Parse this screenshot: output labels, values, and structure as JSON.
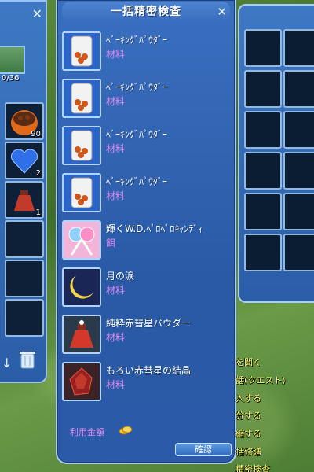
{
  "main": {
    "title": "一括精密検査",
    "items": [
      {
        "name": "ﾍﾞｰｷﾝｸﾞﾊﾟｳﾀﾞｰ",
        "type": "材料",
        "icon": "baking-powder-can-icon"
      },
      {
        "name": "ﾍﾞｰｷﾝｸﾞﾊﾟｳﾀﾞｰ",
        "type": "材料",
        "icon": "baking-powder-can-icon"
      },
      {
        "name": "ﾍﾞｰｷﾝｸﾞﾊﾟｳﾀﾞｰ",
        "type": "材料",
        "icon": "baking-powder-can-icon"
      },
      {
        "name": "ﾍﾞｰｷﾝｸﾞﾊﾟｳﾀﾞｰ",
        "type": "材料",
        "icon": "baking-powder-can-icon"
      },
      {
        "name": "輝くW.D.ﾍﾟﾛﾍﾟﾛｷｬﾝﾃﾞｨ",
        "type": "餌",
        "icon": "lollipop-candy-icon"
      },
      {
        "name": "月の涙",
        "type": "材料",
        "icon": "crescent-moon-icon"
      },
      {
        "name": "純粋赤彗星パウダー",
        "type": "材料",
        "icon": "red-powder-pouch-icon"
      },
      {
        "name": "もろい赤彗星の結晶",
        "type": "材料",
        "icon": "red-crystal-icon"
      }
    ],
    "fee_label": "利用金額",
    "confirm_label": "確認"
  },
  "left": {
    "top_count": "0/36",
    "slots": [
      {
        "icon": "food-bowl-icon",
        "count": "90"
      },
      {
        "icon": "blue-heart-icon",
        "count": "2"
      },
      {
        "icon": "red-pouch-icon",
        "count": "1"
      },
      {
        "icon": "",
        "count": ""
      },
      {
        "icon": "",
        "count": ""
      },
      {
        "icon": "",
        "count": ""
      }
    ]
  },
  "menu": [
    "を聞く",
    "話(クエスト)",
    "入する",
    "分する",
    "縮する",
    "括修繕",
    "精密検査"
  ]
}
